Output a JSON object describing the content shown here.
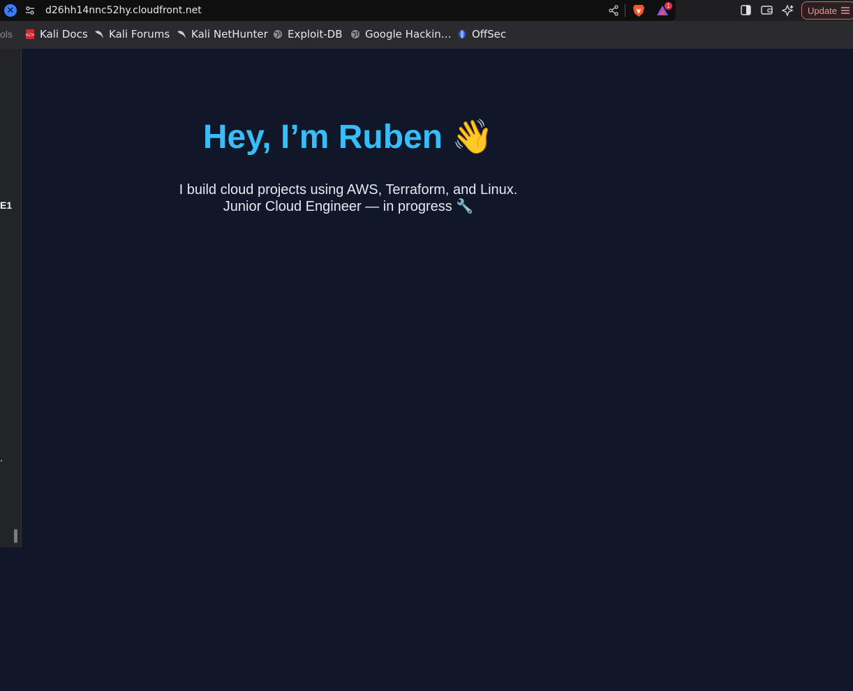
{
  "browser": {
    "url": "d26hh14nnc52hy.cloudfront.net",
    "rewards_badge": "1",
    "update_label": "Update",
    "accent": "#3b7cff"
  },
  "bookmarks": {
    "fragment": "ols",
    "items": [
      {
        "label": "Kali Docs",
        "icon": "kali-docs-icon"
      },
      {
        "label": "Kali Forums",
        "icon": "kali-dragon-icon"
      },
      {
        "label": "Kali NetHunter",
        "icon": "kali-dragon-icon"
      },
      {
        "label": "Exploit-DB",
        "icon": "globe-icon"
      },
      {
        "label": "Google Hackin…",
        "icon": "globe-icon"
      },
      {
        "label": "OffSec",
        "icon": "offsec-icon"
      }
    ]
  },
  "side_panel": {
    "fragment_1": "E1",
    "fragment_2": "."
  },
  "page": {
    "title": "Hey, I’m Ruben 👋",
    "line1": "I build cloud projects using AWS, Terraform, and Linux.",
    "line2": "Junior Cloud Engineer — in progress 🔧",
    "title_color": "#38bdf8",
    "background": "#101729"
  }
}
